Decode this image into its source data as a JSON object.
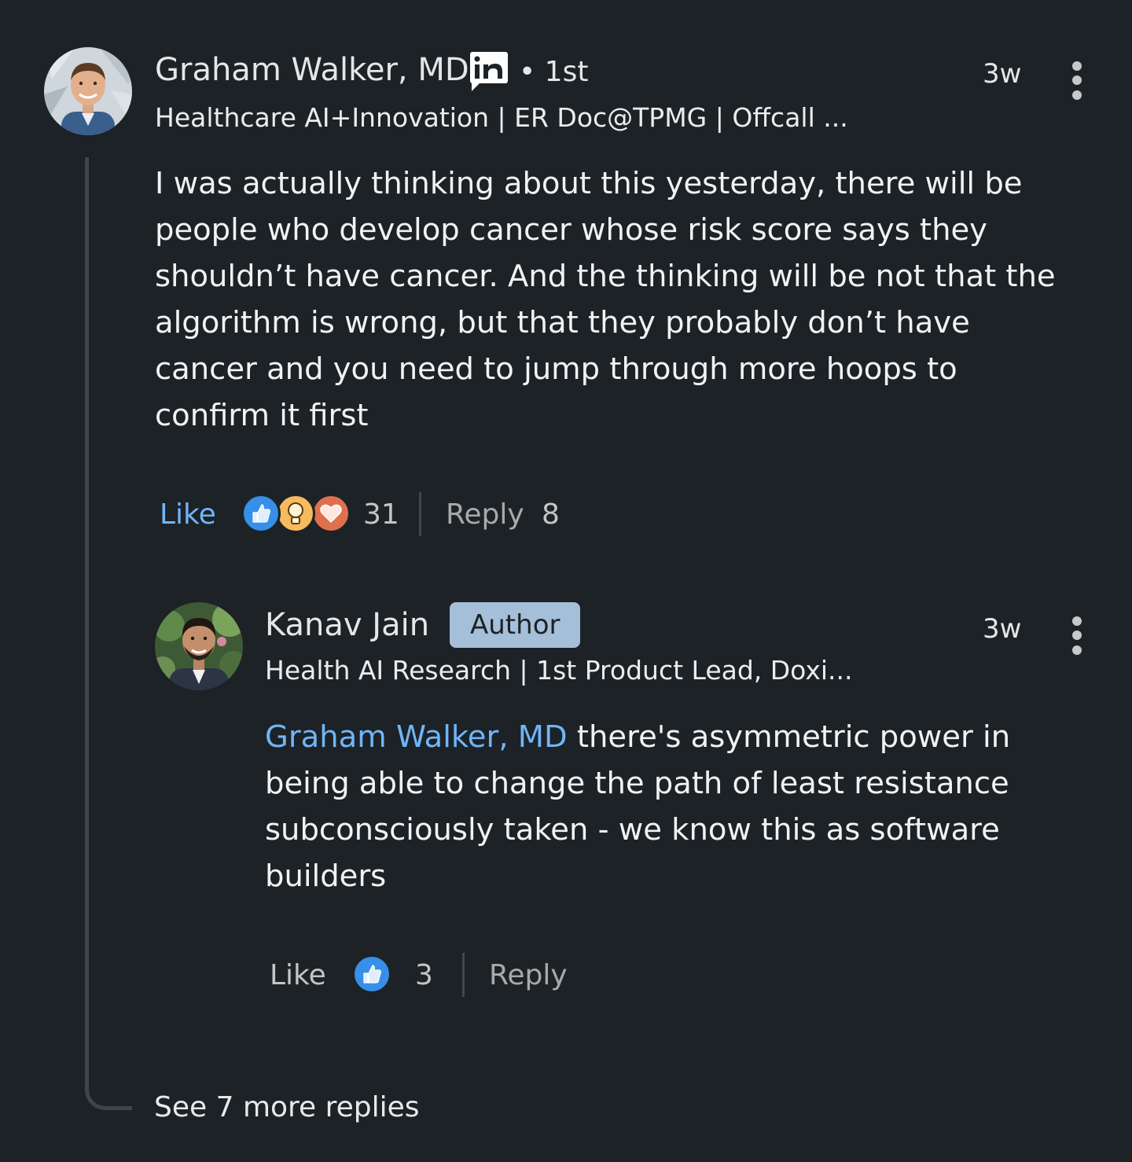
{
  "comment": {
    "author": "Graham Walker, MD",
    "degree": "• 1st",
    "headline": "Healthcare AI+Innovation | ER Doc@TPMG | Offcall ...",
    "time": "3w",
    "text": "I was actually thinking about this yesterday, there will be\npeople who develop cancer whose risk score says they\nshouldn’t have cancer.  And the thinking will be not that the\nalgorithm is wrong, but that they probably don’t have\ncancer and you need to jump through more hoops to\nconfirm it first",
    "like_label": "Like",
    "reaction_count": "31",
    "reply_label": "Reply",
    "reply_count": "8",
    "reactions": [
      "like-icon",
      "insightful-icon",
      "love-icon"
    ],
    "icons": {
      "menu": "more-vertical-icon",
      "badge": "linkedin-icon"
    }
  },
  "reply": {
    "author": "Kanav Jain",
    "author_badge": "Author",
    "headline": "Health AI Research | 1st Product Lead, Doxi...",
    "time": "3w",
    "mention": "Graham Walker, MD",
    "text": " there's asymmetric power in\nbeing able to change the path of least resistance\nsubconsciously taken - we know this as software\nbuilders",
    "like_label": "Like",
    "reaction_count": "3",
    "reply_label": "Reply",
    "reactions": [
      "like-icon"
    ]
  },
  "see_more": "See 7 more replies",
  "colors": {
    "background": "#1d2226",
    "link": "#70b5f9",
    "author_badge": "#a6bfd8",
    "like_reaction": "#378fe9",
    "insightful_reaction": "#f5bb5c",
    "love_reaction": "#df704d"
  }
}
